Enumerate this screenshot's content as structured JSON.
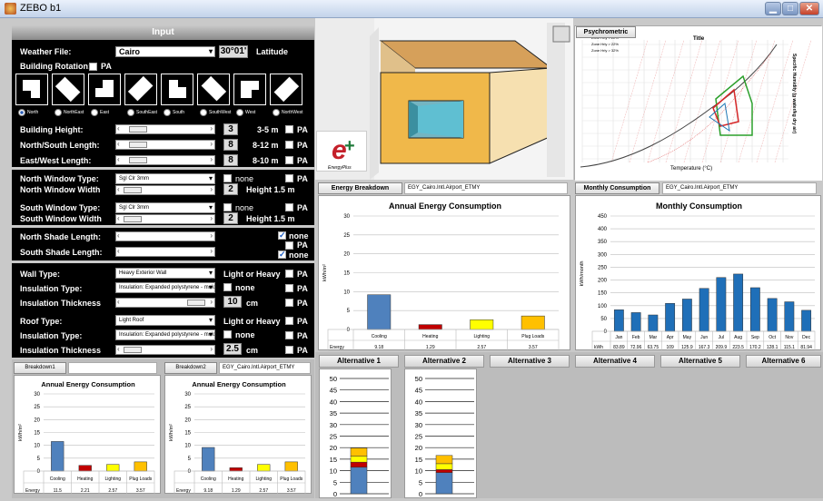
{
  "window": {
    "title": "ZEBO b1",
    "minimize": "▁",
    "maximize": "□",
    "close": "✕"
  },
  "input": {
    "header": "Input",
    "weather_label": "Weather File:",
    "weather_value": "Cairo",
    "latitude_value": "30°01'",
    "latitude_label": "Latitude",
    "rotation_label": "Building Rotation:",
    "rotation_pa": "PA",
    "orientations": [
      "North",
      "NorthEast",
      "East",
      "SouthEast",
      "South",
      "SouthWest",
      "West",
      "NorthWest"
    ],
    "selected_orientation": "North",
    "building_height_label": "Building Height:",
    "building_height_value": "3",
    "building_height_range": "3-5 m",
    "ns_length_label": "North/South Length:",
    "ns_length_value": "8",
    "ns_length_range": "8-12 m",
    "ew_length_label": "East/West Length:",
    "ew_length_value": "8",
    "ew_length_range": "8-10 m",
    "pa": "PA",
    "north_window_type_label": "North Window Type:",
    "north_window_type_value": "Sgl Clr 3mm",
    "north_window_width_label": "North Window Width",
    "north_window_width_value": "2",
    "north_window_height": "Height 1.5 m",
    "none": "none",
    "south_window_type_label": "South Window Type:",
    "south_window_type_value": "Sgl Clr 3mm",
    "south_window_width_label": "South Window Width",
    "south_window_width_value": "2",
    "south_window_height": "Height 1.5 m",
    "north_shade_label": "North Shade Length:",
    "south_shade_label": "South Shade Length:",
    "wall_type_label": "Wall Type:",
    "wall_type_value": "Heavy Exterior Wall",
    "light_or_heavy": "Light or Heavy",
    "wall_insulation_label": "Insulation Type:",
    "wall_insulation_value": "Insulation: Expanded polystyrene - mold",
    "wall_insulation_thickness_label": "Insulation Thickness",
    "wall_insulation_thickness_value": "10",
    "cm": "cm",
    "roof_type_label": "Roof Type:",
    "roof_type_value": "Light Roof",
    "roof_insulation_label": "Insulation Type:",
    "roof_insulation_value": "Insulation: Expanded polystyrene - mold",
    "roof_insulation_thickness_label": "Insulation Thickness",
    "roof_insulation_thickness_value": "2.5"
  },
  "logo": {
    "subtitle": "EnergyPlus"
  },
  "psychrometric": {
    "tab": "Psychrometric",
    "title": "Title",
    "xlabel": "Temperature (°C)",
    "ylabel": "Specific Humidity (g water/kg dry air)",
    "legend": [
      "Zone Hrly < 22%",
      "Zone Hrly > 22%",
      "Zone Hrly > 32%"
    ]
  },
  "energy_breakdown": {
    "tab": "Energy Breakdown",
    "file": "EGY_Cairo.Intl.Airport_ETMY"
  },
  "monthly": {
    "tab": "Monthly Consumption",
    "file": "EGY_Cairo.Intl.Airport_ETMY"
  },
  "breakdown1": {
    "tab": "Breakdown1",
    "file": ""
  },
  "breakdown2": {
    "tab": "Breakdown2",
    "file": "EGY_Cairo.Intl.Airport_ETMY"
  },
  "alternatives": [
    "Alternative 1",
    "Alternative 2",
    "Alternative 3",
    "Alternative 4",
    "Alternative 5",
    "Alternative 6"
  ],
  "chart_data": [
    {
      "id": "main",
      "type": "bar",
      "title": "Annual Energy Consumption",
      "ylabel": "kWh/m²",
      "categories": [
        "Cooling",
        "Heating",
        "Lighting",
        "Plug Loads"
      ],
      "values": [
        9.18,
        1.29,
        2.57,
        3.57
      ],
      "table_row_label": "Energy",
      "table_values": [
        "9.18",
        "1.29",
        "2.57",
        "3.57"
      ],
      "colors": [
        "#4f81bd",
        "#c00000",
        "#ffff00",
        "#ffc000"
      ],
      "ylim": [
        0,
        30
      ],
      "yticks": [
        0,
        5,
        10,
        15,
        20,
        25,
        30
      ]
    },
    {
      "id": "monthly",
      "type": "bar",
      "title": "Monthly Consumption",
      "ylabel": "kWh/month",
      "categories": [
        "Jan",
        "Feb",
        "Mar",
        "Apr",
        "May",
        "Jun",
        "Jul",
        "Aug",
        "Sep",
        "Oct",
        "Nov",
        "Dec"
      ],
      "values": [
        83.89,
        72.96,
        63.75,
        109,
        125.9,
        167.3,
        209.9,
        223.5,
        170.2,
        128.1,
        115.1,
        81.94
      ],
      "table_row_label": "kWh",
      "table_values": [
        "83.89",
        "72.96",
        "63.75",
        "109",
        "125.9",
        "167.3",
        "209.9",
        "223.5",
        "170.2",
        "128.1",
        "115.1",
        "81.94"
      ],
      "colors": [
        "#1f6fb8"
      ],
      "ylim": [
        0,
        450
      ],
      "yticks": [
        0,
        50,
        100,
        150,
        200,
        250,
        300,
        350,
        400,
        450
      ]
    },
    {
      "id": "b1",
      "type": "bar",
      "title": "Annual Energy Consumption",
      "ylabel": "kWh/m²",
      "categories": [
        "Cooling",
        "Heating",
        "Lighting",
        "Plug Loads"
      ],
      "values": [
        11.5,
        2.21,
        2.57,
        3.57
      ],
      "table_row_label": "Energy",
      "table_values": [
        "11.5",
        "2.21",
        "2.57",
        "3.57"
      ],
      "colors": [
        "#4f81bd",
        "#c00000",
        "#ffff00",
        "#ffc000"
      ],
      "ylim": [
        0,
        30
      ],
      "yticks": [
        0,
        5,
        10,
        15,
        20,
        25,
        30
      ]
    },
    {
      "id": "b2",
      "type": "bar",
      "title": "Annual Energy Consumption",
      "ylabel": "kWh/m²",
      "categories": [
        "Cooling",
        "Heating",
        "Lighting",
        "Plug Loads"
      ],
      "values": [
        9.18,
        1.29,
        2.57,
        3.57
      ],
      "table_row_label": "Energy",
      "table_values": [
        "9.18",
        "1.29",
        "2.57",
        "3.57"
      ],
      "colors": [
        "#4f81bd",
        "#c00000",
        "#ffff00",
        "#ffc000"
      ],
      "ylim": [
        0,
        30
      ],
      "yticks": [
        0,
        5,
        10,
        15,
        20,
        25,
        30
      ]
    },
    {
      "id": "alt1",
      "type": "bar",
      "stacked": true,
      "yticks": [
        0,
        5,
        10,
        15,
        20,
        25,
        30,
        35,
        40,
        45,
        50
      ],
      "ylim": [
        0,
        50
      ],
      "segments": [
        11.5,
        2.21,
        2.57,
        3.57
      ],
      "colors": [
        "#4f81bd",
        "#c00000",
        "#ffff00",
        "#ffc000"
      ]
    },
    {
      "id": "alt2",
      "type": "bar",
      "stacked": true,
      "yticks": [
        0,
        5,
        10,
        15,
        20,
        25,
        30,
        35,
        40,
        45,
        50
      ],
      "ylim": [
        0,
        50
      ],
      "segments": [
        9.18,
        1.29,
        2.57,
        3.57
      ],
      "colors": [
        "#4f81bd",
        "#c00000",
        "#ffff00",
        "#ffc000"
      ]
    }
  ]
}
